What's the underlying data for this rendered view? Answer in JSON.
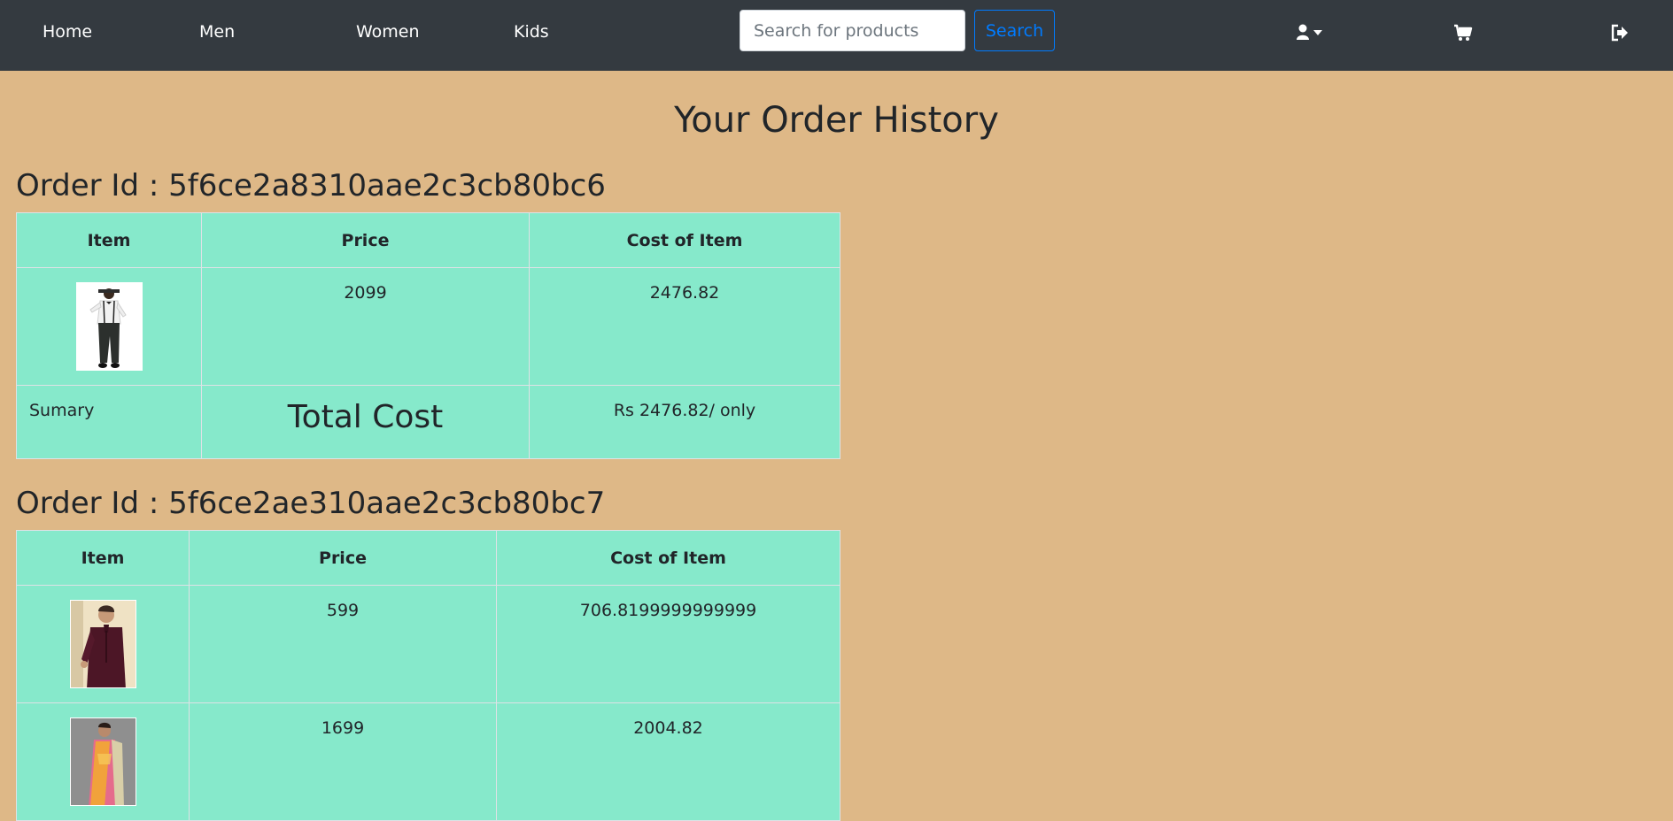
{
  "nav": {
    "home": "Home",
    "men": "Men",
    "women": "Women",
    "kids": "Kids",
    "search_placeholder": "Search for products",
    "search_button": "Search",
    "icons": {
      "user": "user-icon",
      "caret": "caret-down-icon",
      "cart": "shopping-cart-icon",
      "logout": "sign-out-icon"
    }
  },
  "page": {
    "title": "Your Order History"
  },
  "columns": {
    "item": "Item",
    "price": "Price",
    "cost": "Cost of Item"
  },
  "orders": [
    {
      "heading": "Order Id : 5f6ce2a8310aae2c3cb80bc6",
      "items": [
        {
          "image": "boy-suspenders-outfit",
          "price": "2099",
          "cost": "2476.82"
        }
      ],
      "summary": {
        "label": "Sumary",
        "total_label": "Total Cost",
        "total_value": "Rs 2476.82/ only"
      }
    },
    {
      "heading": "Order Id : 5f6ce2ae310aae2c3cb80bc7",
      "items": [
        {
          "image": "man-maroon-kurta",
          "price": "599",
          "cost": "706.8199999999999"
        },
        {
          "image": "woman-ethnic-outfit",
          "price": "1699",
          "cost": "2004.82"
        }
      ]
    }
  ],
  "colors": {
    "navbar": "#343a40",
    "page_background": "#deb887",
    "table_background": "#86e9cb",
    "search_accent": "#007bff"
  }
}
